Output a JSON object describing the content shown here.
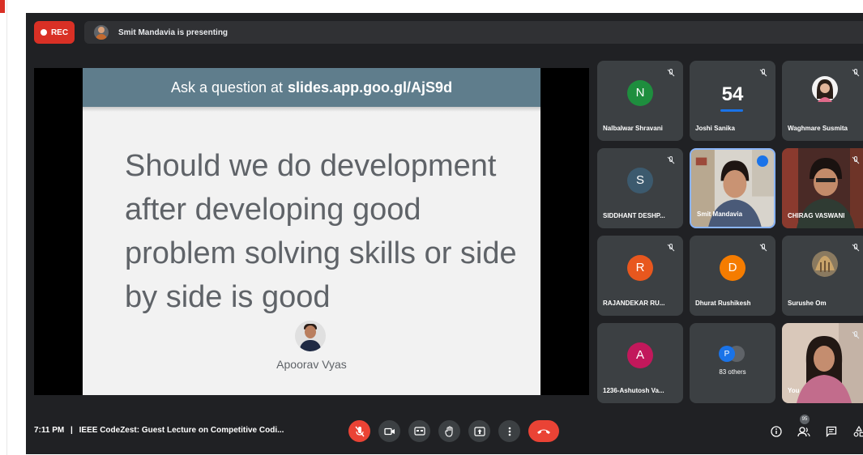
{
  "top_bar": {
    "rec_label": "REC",
    "presenting_text": "Smit Mandavia is presenting"
  },
  "slide": {
    "header_prefix": "Ask a question at",
    "header_link": "slides.app.goo.gl/AjS9d",
    "question_lines": [
      "Should we do development",
      "after developing good",
      "problem solving skills or side",
      "by side is good"
    ],
    "asker_name": "Apoorav Vyas"
  },
  "participants": [
    {
      "name": "Nalbalwar Shravani",
      "initial": "N",
      "color": "#1e8e3e",
      "muted": true
    },
    {
      "name": "Joshi Sanika",
      "initial": "54",
      "muted": true
    },
    {
      "name": "Waghmare Susmita",
      "muted": true
    },
    {
      "name": "SIDDHANT DESHP...",
      "initial": "S",
      "color": "#3c5a6e",
      "muted": true
    },
    {
      "name": "Smit Mandavia",
      "speaking": true
    },
    {
      "name": "CHIRAG VASWANI",
      "muted": true
    },
    {
      "name": "RAJANDEKAR RU...",
      "initial": "R",
      "color": "#e8571e",
      "muted": true
    },
    {
      "name": "Dhurat Rushikesh",
      "initial": "D",
      "color": "#f57c00",
      "muted": true
    },
    {
      "name": "Surushe Om",
      "muted": true
    },
    {
      "name": "1236-Ashutosh Va...",
      "initial": "A",
      "color": "#c2185b"
    },
    {
      "name": "83 others",
      "initial": "P",
      "color": "#1a73e8"
    },
    {
      "name": "You",
      "muted": true
    }
  ],
  "bottom_bar": {
    "time": "7:11 PM",
    "separator": "|",
    "meeting_title": "IEEE CodeZest: Guest Lecture on Competitive Codi...",
    "people_count": "95"
  },
  "icons": {
    "mic_off": "mic-off-icon",
    "camera": "camera-icon",
    "captions": "captions-icon",
    "raise_hand": "raise-hand-icon",
    "present": "present-screen-icon",
    "more": "more-options-icon",
    "end_call": "end-call-icon",
    "info": "info-icon",
    "people": "people-icon",
    "chat": "chat-icon",
    "activities": "activities-icon"
  },
  "colors": {
    "accent_red": "#ea4335",
    "slide_header": "#5f7d8c",
    "meet_background": "#202124",
    "tile_background": "#3c4043"
  }
}
